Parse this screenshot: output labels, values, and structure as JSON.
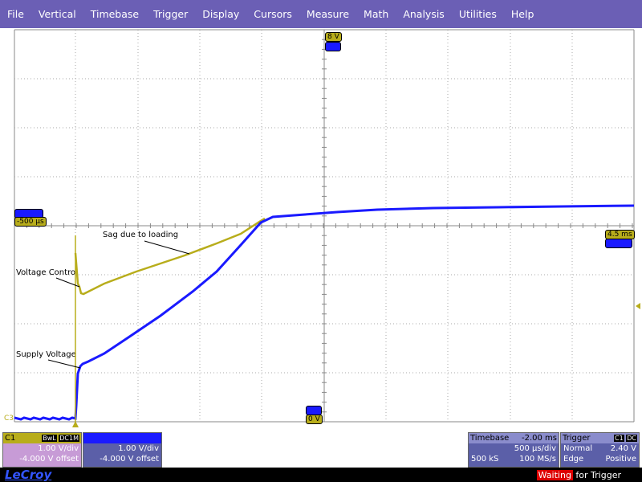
{
  "menu": [
    "File",
    "Vertical",
    "Timebase",
    "Trigger",
    "Display",
    "Cursors",
    "Measure",
    "Math",
    "Analysis",
    "Utilities",
    "Help"
  ],
  "colors": {
    "c1": "#b8ad1b",
    "c2": "#1a1aff",
    "grid": "#999999",
    "menubar": "#6b5fb5"
  },
  "markers": {
    "top_level": "8 V",
    "bottom_level": "0 V",
    "left_time": "-500 µs",
    "right_time": "4.5 ms",
    "ground_label": "C3"
  },
  "annotations": {
    "sag": "Sag due to loading",
    "vcontrol": "Voltage Control",
    "supply": "Supply Voltage"
  },
  "channel1": {
    "name": "C1",
    "bwl": "BwL",
    "coupling": "DC1M",
    "vdiv": "1.00 V/div",
    "offset": "-4.000 V offset"
  },
  "channel2": {
    "vdiv": "1.00 V/div",
    "offset": "-4.000 V offset"
  },
  "timebase": {
    "label": "Timebase",
    "delay": "-2.00 ms",
    "tdiv": "500 µs/div",
    "samples": "500 kS",
    "rate": "100 MS/s"
  },
  "trigger": {
    "label": "Trigger",
    "source": "C1",
    "coupling": "DC",
    "mode": "Normal",
    "level": "2.40 V",
    "type": "Edge",
    "slope": "Positive"
  },
  "footer": {
    "brand": "LeCroy",
    "status_red": "Waiting",
    "status_rest": " for Trigger"
  }
}
